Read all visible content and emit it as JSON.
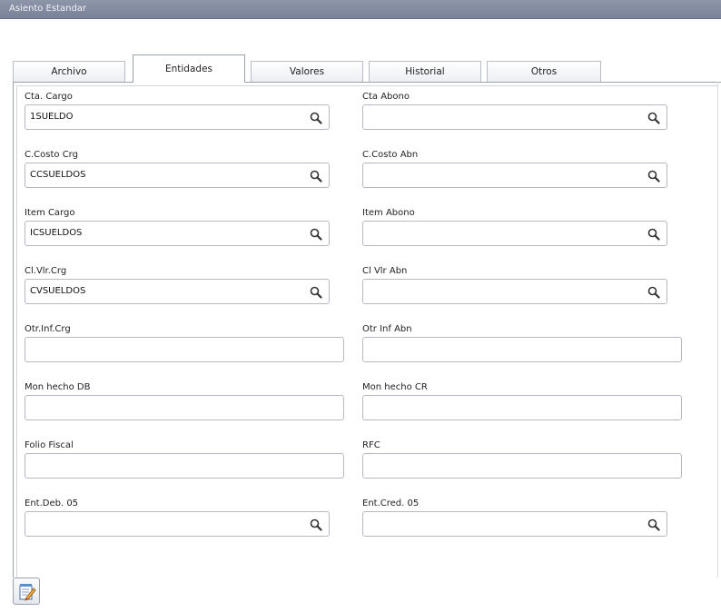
{
  "window": {
    "title": "Asiento Estandar"
  },
  "tabs": [
    {
      "label": "Archivo"
    },
    {
      "label": "Entidades"
    },
    {
      "label": "Valores"
    },
    {
      "label": "Historial"
    },
    {
      "label": "Otros"
    }
  ],
  "fields": {
    "cta_cargo": {
      "label": "Cta. Cargo",
      "value": "1SUELDO"
    },
    "cta_abono": {
      "label": "Cta Abono",
      "value": ""
    },
    "ccosto_crg": {
      "label": "C.Costo Crg",
      "value": "CCSUELDOS"
    },
    "ccosto_abn": {
      "label": "C.Costo Abn",
      "value": ""
    },
    "item_cargo": {
      "label": "Item Cargo",
      "value": "ICSUELDOS"
    },
    "item_abono": {
      "label": "Item Abono",
      "value": ""
    },
    "clvlr_crg": {
      "label": "Cl.Vlr.Crg",
      "value": "CVSUELDOS"
    },
    "clvlr_abn": {
      "label": "Cl Vlr Abn",
      "value": ""
    },
    "otrinf_crg": {
      "label": "Otr.Inf.Crg",
      "value": ""
    },
    "otrinf_abn": {
      "label": "Otr Inf Abn",
      "value": ""
    },
    "mon_hecho_db": {
      "label": "Mon hecho DB",
      "value": ""
    },
    "mon_hecho_cr": {
      "label": "Mon hecho CR",
      "value": ""
    },
    "folio_fiscal": {
      "label": "Folio Fiscal",
      "value": ""
    },
    "rfc": {
      "label": "RFC",
      "value": ""
    },
    "ent_deb_05": {
      "label": "Ent.Deb. 05",
      "value": ""
    },
    "ent_cred_05": {
      "label": "Ent.Cred. 05",
      "value": ""
    }
  },
  "icons": {
    "search": "search-icon",
    "edit": "edit-note-icon"
  }
}
